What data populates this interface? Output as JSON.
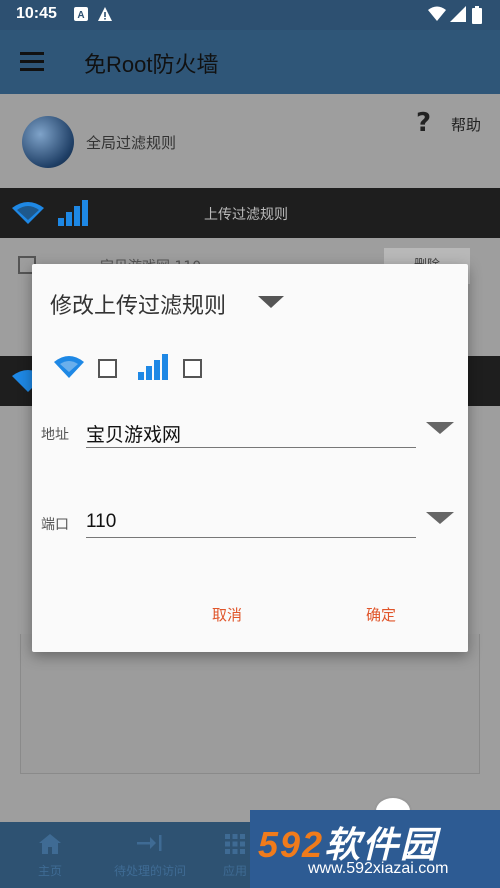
{
  "status": {
    "time": "10:45"
  },
  "appbar": {
    "title": "免Root防火墙"
  },
  "global": {
    "label": "全局过滤规则",
    "help": "帮助"
  },
  "upload_section": {
    "label": "上传过滤规则"
  },
  "rule_row": {
    "text": "宝贝游戏网 110",
    "delete_label": "删除"
  },
  "dialog": {
    "title": "修改上传过滤规则",
    "address_label": "地址",
    "address_value": "宝贝游戏网",
    "port_label": "端口",
    "port_value": "110",
    "cancel": "取消",
    "confirm": "确定"
  },
  "bottom_nav": [
    {
      "label": "主页",
      "icon": "home-icon"
    },
    {
      "label": "待处理的访问",
      "icon": "pending-access-icon"
    },
    {
      "label": "应用",
      "icon": "apps-icon"
    }
  ],
  "watermark": {
    "brand_num": "592",
    "brand_text": "软件园",
    "url": "www.592xiazai.com"
  },
  "colors": {
    "accent_blue": "#1e88e5",
    "button_orange": "#e0552a",
    "appbar": "#2f5678"
  }
}
